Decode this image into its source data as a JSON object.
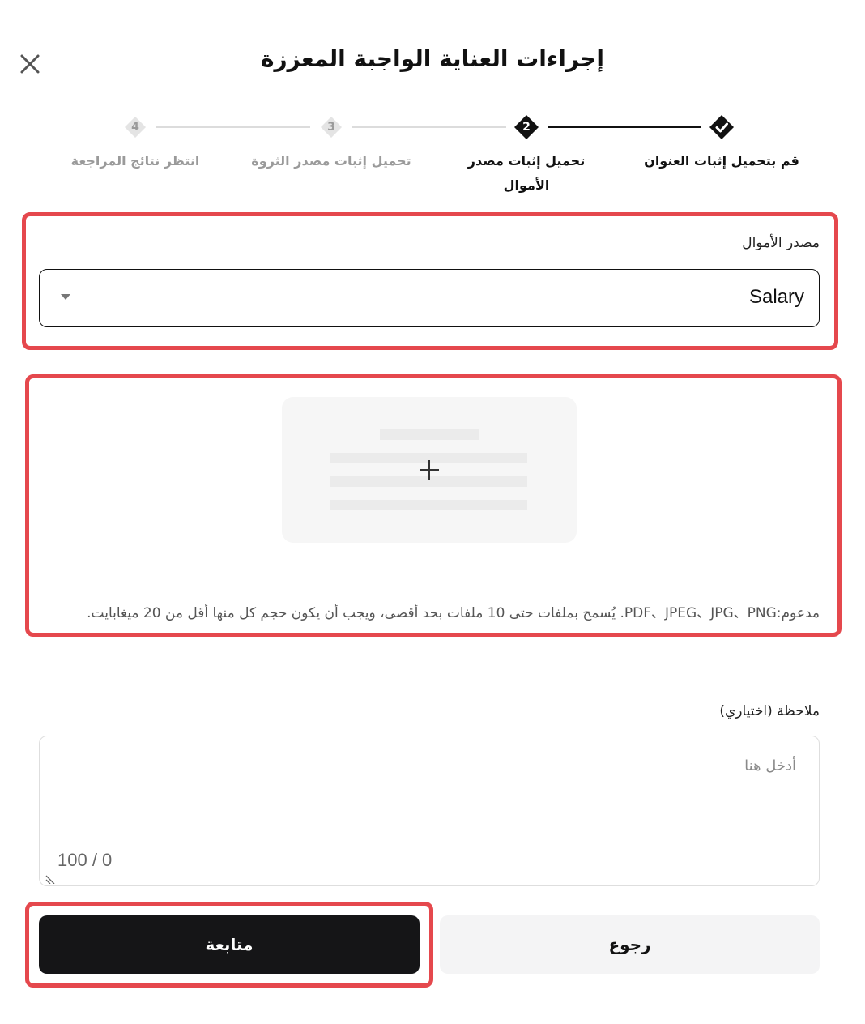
{
  "dialog": {
    "title": "إجراءات العناية الواجبة المعززة",
    "close_icon": "close-icon"
  },
  "stepper": {
    "steps": [
      {
        "number": "",
        "label": "قم بتحميل إثبات العنوان",
        "status": "done",
        "icon": "check-icon"
      },
      {
        "number": "2",
        "label": "تحميل إثبات مصدر الأموال",
        "status": "current",
        "icon": ""
      },
      {
        "number": "3",
        "label": "تحميل إثبات مصدر الثروة",
        "status": "pending",
        "icon": ""
      },
      {
        "number": "4",
        "label": "انتظر نتائج المراجعة",
        "status": "pending",
        "icon": ""
      }
    ]
  },
  "funds_source": {
    "label": "مصدر الأموال",
    "selected": "Salary",
    "caret_icon": "caret-down-icon"
  },
  "upload": {
    "icon": "plus-icon",
    "hint": "مدعوم:PDF、JPEG、JPG、PNG. يُسمح بملفات حتى 10 ملفات بحد أقصى، ويجب أن يكون حجم كل منها أقل من 20 ميغابايت."
  },
  "note": {
    "label": "ملاحظة (اختياري)",
    "placeholder": "أدخل هنا",
    "value": "",
    "counter": "100 / 0"
  },
  "actions": {
    "continue_label": "متابعة",
    "back_label": "رجوع"
  },
  "colors": {
    "highlight": "#e5484d",
    "primary_button": "#151517",
    "secondary_button": "#f4f4f5"
  }
}
